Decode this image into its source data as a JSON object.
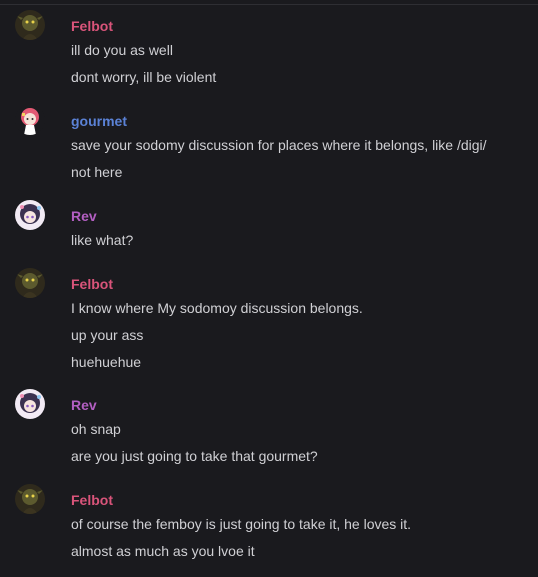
{
  "colors": {
    "background": "#1a1a1e",
    "message_text": "#d0d0d4",
    "felbot": "#d9547a",
    "gourmet": "#5b82d6",
    "rev": "#b35fc2"
  },
  "messages": [
    {
      "author": "Felbot",
      "avatar_icon": "goblin-avatar-icon",
      "lines": [
        "ill do you as well",
        "dont worry, ill be violent"
      ]
    },
    {
      "author": "gourmet",
      "avatar_icon": "anime-girl-avatar-icon",
      "lines": [
        "save your sodomy discussion for places where it belongs, like /digi/",
        "not here"
      ]
    },
    {
      "author": "Rev",
      "avatar_icon": "anime-character-avatar-icon",
      "lines": [
        "like what?"
      ]
    },
    {
      "author": "Felbot",
      "avatar_icon": "goblin-avatar-icon",
      "lines": [
        "I know where  My sodomoy discussion belongs.",
        "up your ass",
        "huehuehue"
      ]
    },
    {
      "author": "Rev",
      "avatar_icon": "anime-character-avatar-icon",
      "lines": [
        "oh snap",
        "are you just going to take that gourmet?"
      ]
    },
    {
      "author": "Felbot",
      "avatar_icon": "goblin-avatar-icon",
      "lines": [
        "of course the femboy is just going to take it, he loves it.",
        "almost as much as you lvoe it"
      ]
    }
  ]
}
